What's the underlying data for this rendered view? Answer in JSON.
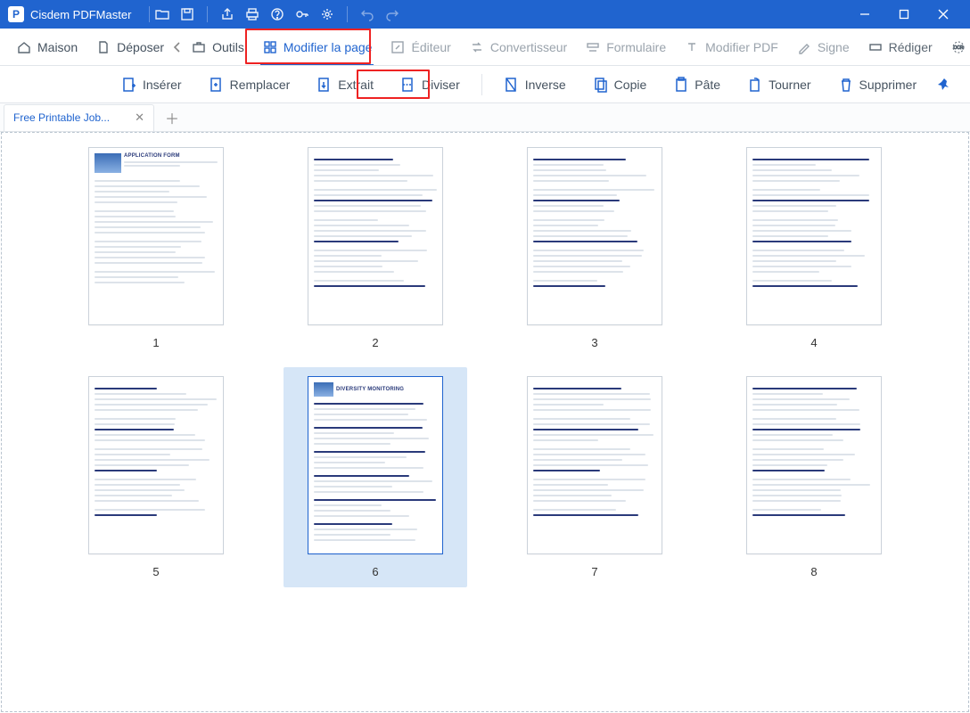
{
  "app": {
    "title": "Cisdem PDFMaster"
  },
  "mainTabs": {
    "home": "Maison",
    "file": "Déposer",
    "tools": "Outils",
    "modifyPage": "Modifier la page",
    "editor": "Éditeur",
    "converter": "Convertisseur",
    "form": "Formulaire",
    "modifyPdf": "Modifier PDF",
    "sign": "Signe",
    "redact": "Rédiger",
    "ocr": "O"
  },
  "toolbar": {
    "insert": "Insérer",
    "replace": "Remplacer",
    "extract": "Extrait",
    "divide": "Diviser",
    "inverse": "Inverse",
    "copy": "Copie",
    "paste": "Pâte",
    "rotate": "Tourner",
    "delete": "Supprimer"
  },
  "docTab": {
    "label": "Free Printable Job..."
  },
  "pages": {
    "total": 8,
    "selected": 6,
    "labels": [
      "1",
      "2",
      "3",
      "4",
      "5",
      "6",
      "7",
      "8"
    ]
  },
  "thumbnails": {
    "1": {
      "header": "APPLICATION FORM"
    },
    "6": {
      "header": "DIVERSITY MONITORING"
    }
  }
}
